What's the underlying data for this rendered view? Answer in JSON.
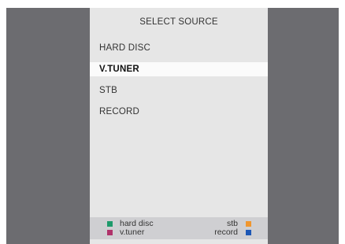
{
  "panel": {
    "title": "SELECT SOURCE",
    "items": [
      {
        "label": "HARD  DISC",
        "selected": false
      },
      {
        "label": "V.TUNER",
        "selected": true
      },
      {
        "label": "STB",
        "selected": false
      },
      {
        "label": "RECORD",
        "selected": false
      }
    ]
  },
  "footer": {
    "keys": [
      {
        "label": "hard disc",
        "color": "#1e9a6b",
        "icon": "green-key-icon"
      },
      {
        "label": "v.tuner",
        "color": "#b0336b",
        "icon": "magenta-key-icon"
      },
      {
        "label": "stb",
        "color": "#f0962e",
        "icon": "orange-key-icon"
      },
      {
        "label": "record",
        "color": "#1d57b5",
        "icon": "blue-key-icon"
      }
    ]
  },
  "colors": {
    "background": "#6c6c70",
    "panel": "#e6e6e6",
    "highlight": "#fbfbfb",
    "footer": "#cfcfd2"
  }
}
